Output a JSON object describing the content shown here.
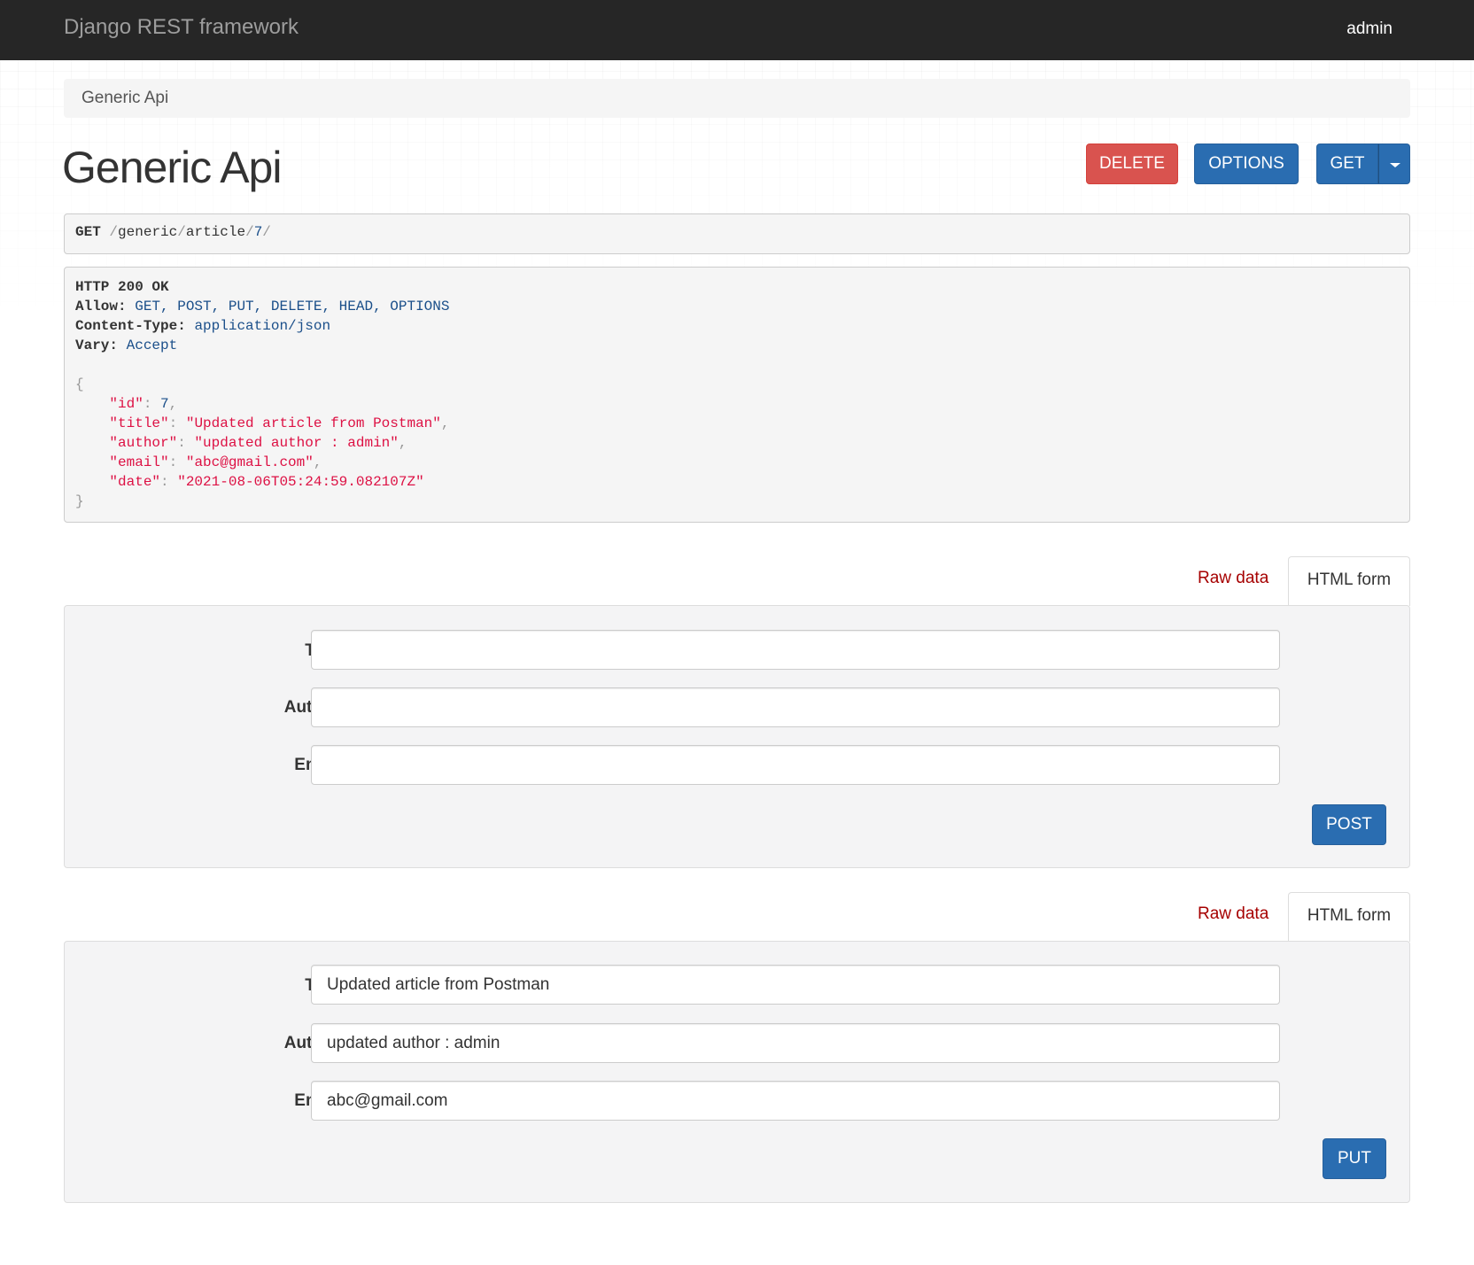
{
  "navbar": {
    "brand": "Django REST framework",
    "user": "admin"
  },
  "breadcrumb": {
    "current": "Generic Api"
  },
  "page": {
    "title": "Generic Api"
  },
  "actions": {
    "delete_label": "DELETE",
    "options_label": "OPTIONS",
    "get_label": "GET"
  },
  "request": {
    "method": "GET",
    "path_segments": [
      "/",
      "generic",
      "/",
      "article",
      "/",
      "7",
      "/"
    ]
  },
  "response": {
    "status_line": "HTTP 200 OK",
    "headers": [
      {
        "name": "Allow:",
        "value": "GET, POST, PUT, DELETE, HEAD, OPTIONS"
      },
      {
        "name": "Content-Type:",
        "value": "application/json"
      },
      {
        "name": "Vary:",
        "value": "Accept"
      }
    ],
    "body": {
      "id": 7,
      "title": "Updated article from Postman",
      "author": "updated author : admin",
      "email": "abc@gmail.com",
      "date": "2021-08-06T05:24:59.082107Z"
    }
  },
  "post_form": {
    "tab_raw": "Raw data",
    "tab_html": "HTML form",
    "title_label": "Title",
    "author_label": "Author",
    "email_label": "Email",
    "title_value": "",
    "author_value": "",
    "email_value": "",
    "submit_label": "POST"
  },
  "put_form": {
    "tab_raw": "Raw data",
    "tab_html": "HTML form",
    "title_label": "Title",
    "author_label": "Author",
    "email_label": "Email",
    "title_value": "Updated article from Postman",
    "author_value": "updated author : admin",
    "email_value": "abc@gmail.com",
    "submit_label": "PUT"
  },
  "colors": {
    "navbar_bg": "#262626",
    "primary": "#2a6db1",
    "danger": "#d9534f",
    "link_red": "#a60000"
  }
}
